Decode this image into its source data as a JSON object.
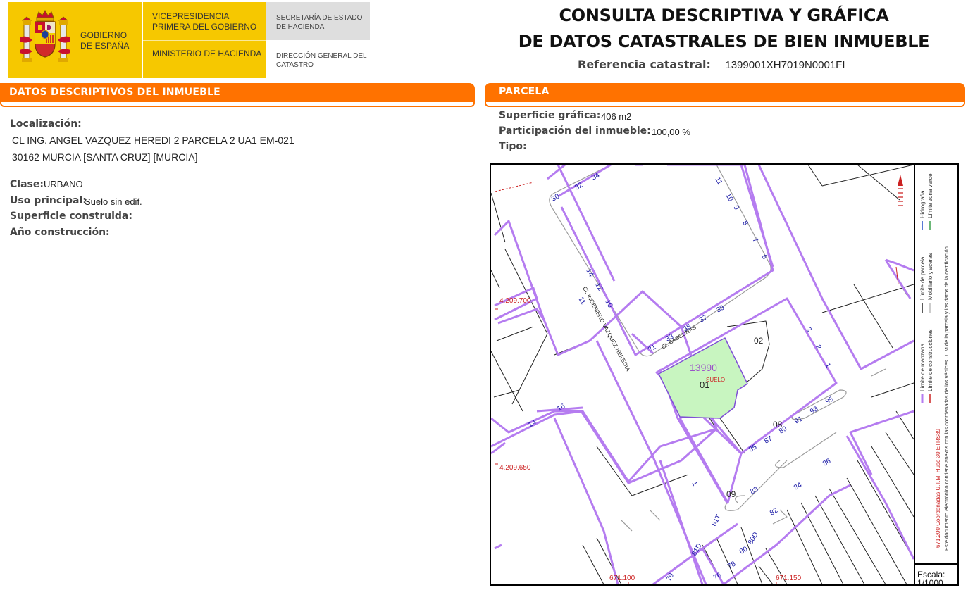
{
  "header": {
    "gobierno": "GOBIERNO DE ESPAÑA",
    "vicepresidencia": "VICEPRESIDENCIA PRIMERA DEL GOBIERNO",
    "ministerio": "MINISTERIO DE HACIENDA",
    "secretaria": "SECRETARÍA DE ESTADO DE HACIENDA",
    "direccion": "DIRECCIÓN GENERAL DEL CATASTRO"
  },
  "title": {
    "line1": "CONSULTA DESCRIPTIVA Y GRÁFICA",
    "line2": "DE DATOS CATASTRALES DE BIEN INMUEBLE",
    "ref_label": "Referencia catastral:",
    "ref_value": "1399001XH7019N0001FI"
  },
  "descriptivos": {
    "section_title": "DATOS DESCRIPTIVOS DEL INMUEBLE",
    "localizacion_label": "Localización:",
    "localizacion_line1": "CL ING. ANGEL VAZQUEZ HEREDI 2 PARCELA 2 UA1 EM-021",
    "localizacion_line2": "30162 MURCIA [SANTA CRUZ] [MURCIA]",
    "clase_label": "Clase:",
    "clase_value": "URBANO",
    "uso_label": "Uso principal:",
    "uso_value": "Suelo sin edif.",
    "superficie_construida_label": "Superficie construida:",
    "anio_label": "Año construcción:"
  },
  "parcela": {
    "section_title": "PARCELA",
    "superficie_label": "Superficie gráfica:",
    "superficie_value": "406 m2",
    "participacion_label": "Participación del inmueble:",
    "participacion_value": "100,00 %",
    "tipo_label": "Tipo:"
  },
  "map": {
    "coords": {
      "y1": "4.209.700",
      "y2": "4.209.650",
      "x1": "671.100",
      "x2": "671.150"
    },
    "parcel_number": "13990",
    "parcel_sub": "01",
    "suelo": "SUELO",
    "subparcels": [
      "02",
      "08",
      "09"
    ],
    "streets": [
      "CL INGENIERO VAZQUEZ HEREDIA",
      "CL BASCUÑAS"
    ],
    "house_numbers": [
      "30",
      "32",
      "34",
      "11",
      "10",
      "9",
      "8",
      "7",
      "6",
      "14",
      "12",
      "10",
      "11",
      "31",
      "33",
      "35",
      "37",
      "39",
      "3",
      "2",
      "1",
      "85",
      "87",
      "89",
      "91",
      "93",
      "95",
      "83",
      "84",
      "86",
      "82",
      "80",
      "80D",
      "78",
      "76",
      "79",
      "81D",
      "81T",
      "1",
      "14",
      "16"
    ],
    "colors": {
      "manzana": "#b57cf0",
      "parcel_fill": "#c8f5c0",
      "parcel_line": "#7f4fd6",
      "coord_red": "#cc2222",
      "numbers": "#1a1aa6",
      "sidewalk": "#9a9a9a"
    },
    "legend": {
      "col1_a": "Límite de manzana",
      "col1_b": "Límite de parcela",
      "col1_c": "Hidrografía",
      "col2_a": "Límite de construcciones",
      "col2_b": "Mobiliario y aceras",
      "col2_c": "Límite zona verde",
      "coords_note": "671.200 Coordenadas U.T.M. Huso 30 ETRS89",
      "disclaimer": "Este documento electrónico contiene anexos con las coordenadas de los vértices UTM de la parcela y los datos de la certificación"
    },
    "scale_label": "Escala:",
    "scale_value": "1/1000"
  }
}
